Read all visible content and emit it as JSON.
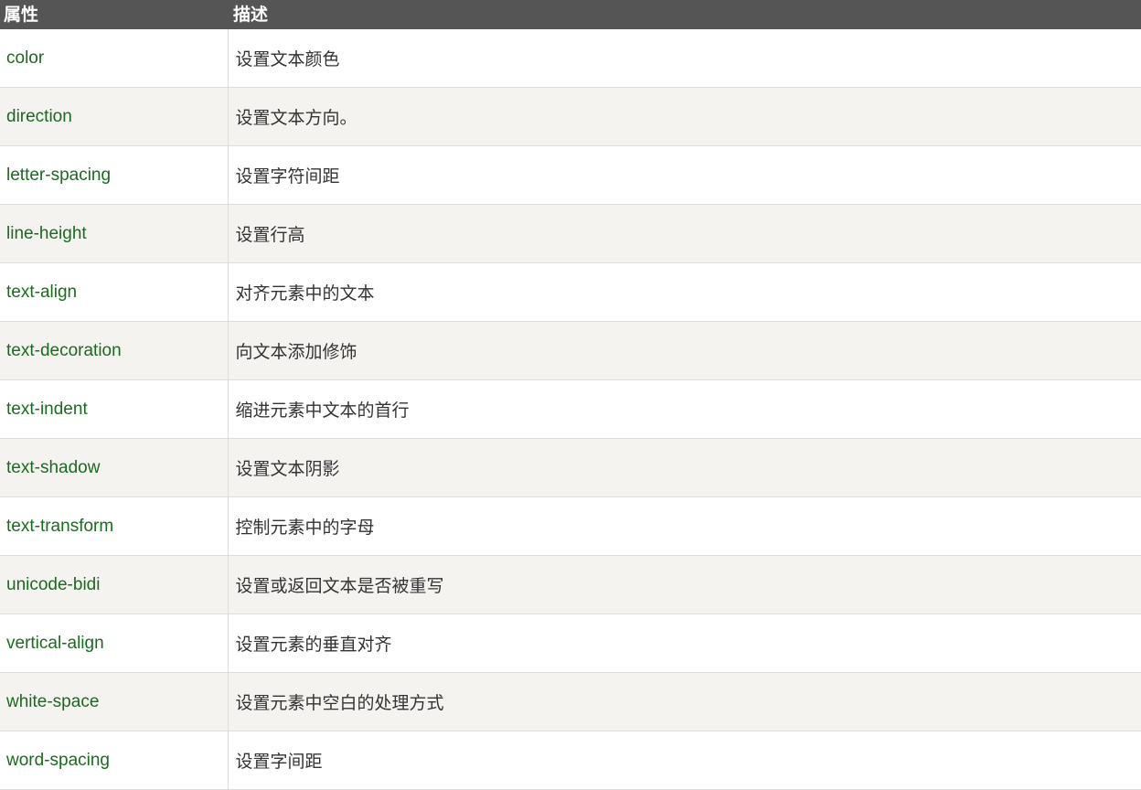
{
  "header": {
    "property": "属性",
    "description": "描述"
  },
  "rows": [
    {
      "property": "color",
      "description": "设置文本颜色"
    },
    {
      "property": "direction",
      "description": "设置文本方向。"
    },
    {
      "property": "letter-spacing",
      "description": "设置字符间距"
    },
    {
      "property": "line-height",
      "description": "设置行高"
    },
    {
      "property": "text-align",
      "description": "对齐元素中的文本"
    },
    {
      "property": "text-decoration",
      "description": "向文本添加修饰"
    },
    {
      "property": "text-indent",
      "description": "缩进元素中文本的首行"
    },
    {
      "property": "text-shadow",
      "description": "设置文本阴影"
    },
    {
      "property": "text-transform",
      "description": "控制元素中的字母"
    },
    {
      "property": "unicode-bidi",
      "description": "设置或返回文本是否被重写"
    },
    {
      "property": "vertical-align",
      "description": "设置元素的垂直对齐"
    },
    {
      "property": "white-space",
      "description": "设置元素中空白的处理方式"
    },
    {
      "property": "word-spacing",
      "description": "设置字间距"
    }
  ],
  "colors": {
    "header_bg": "#555555",
    "header_text": "#ffffff",
    "property_text": "#1a6b1f",
    "description_text": "#333333",
    "alt_row_bg": "#f4f3f0"
  }
}
